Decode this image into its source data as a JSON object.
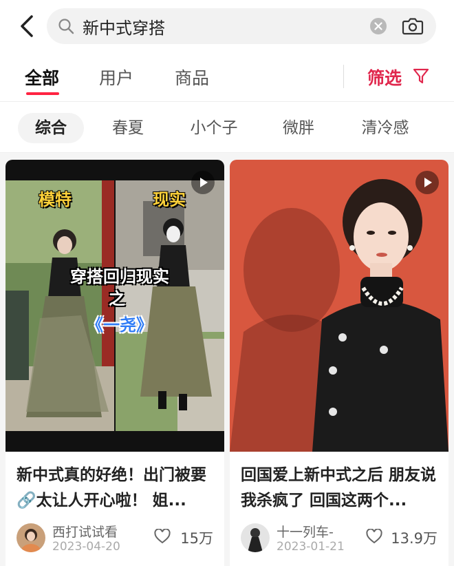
{
  "search": {
    "query": "新中式穿搭"
  },
  "tabs": [
    {
      "label": "全部",
      "active": true
    },
    {
      "label": "用户",
      "active": false
    },
    {
      "label": "商品",
      "active": false
    }
  ],
  "filter": {
    "label": "筛选"
  },
  "subtabs": [
    {
      "label": "综合",
      "active": true
    },
    {
      "label": "春夏",
      "active": false
    },
    {
      "label": "小个子",
      "active": false
    },
    {
      "label": "微胖",
      "active": false
    },
    {
      "label": "清冷感",
      "active": false
    }
  ],
  "colors": {
    "accent": "#ff2442",
    "filter": "#e0264c",
    "card2_bg": "#d8573f"
  },
  "posts": [
    {
      "title": "新中式真的好绝！出门被要🔗太让人开心啦！ 姐...",
      "author": "西打试试看",
      "date": "2023-04-20",
      "likes": "15万",
      "has_video": true,
      "overlay": {
        "left_label": "模特",
        "right_label": "现实",
        "caption_line1": "穿搭回归现实",
        "caption_line2": "之",
        "caption_line3": "《一尧》"
      }
    },
    {
      "title": "回国爱上新中式之后 朋友说我杀疯了 回国这两个...",
      "author": "十一列车-",
      "date": "2023-01-21",
      "likes": "13.9万",
      "has_video": true
    }
  ]
}
